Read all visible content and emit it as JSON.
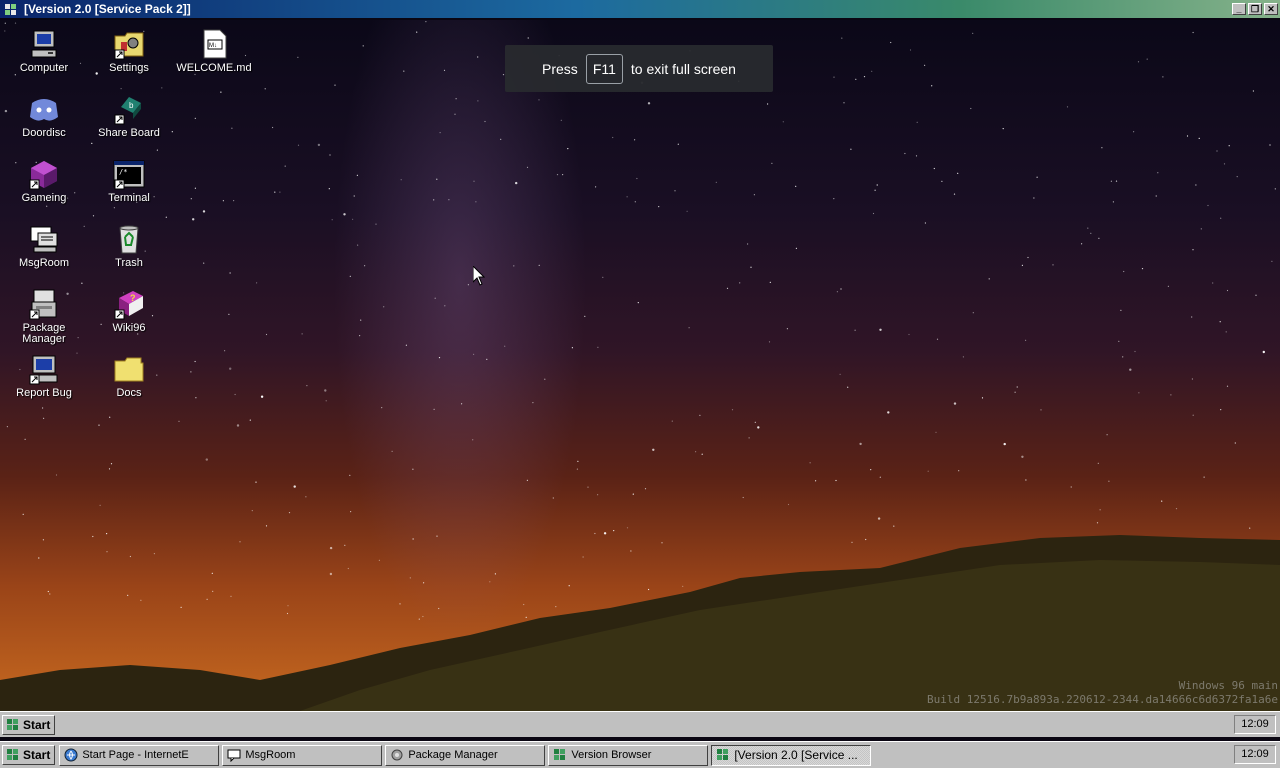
{
  "window": {
    "title": "[Version 2.0 [Service Pack 2]]",
    "controls": [
      "minimize-icon",
      "restore-icon",
      "close-icon"
    ]
  },
  "desktop": {
    "icons": [
      {
        "label": "Computer",
        "icon": "computer-icon"
      },
      {
        "label": "Settings",
        "icon": "settings-icon"
      },
      {
        "label": "WELCOME.md",
        "icon": "markdown-file-icon"
      },
      {
        "label": "Doordisc",
        "icon": "discord-icon"
      },
      {
        "label": "Share Board",
        "icon": "share-board-icon"
      },
      {
        "label": "Gameing",
        "icon": "game-cube-icon"
      },
      {
        "label": "Terminal",
        "icon": "terminal-icon"
      },
      {
        "label": "MsgRoom",
        "icon": "msgroom-icon"
      },
      {
        "label": "Trash",
        "icon": "recycle-bin-icon"
      },
      {
        "label": "Package Manager",
        "icon": "package-manager-icon"
      },
      {
        "label": "Wiki96",
        "icon": "help-book-icon"
      },
      {
        "label": "Report Bug",
        "icon": "report-bug-icon"
      },
      {
        "label": "Docs",
        "icon": "folder-icon"
      }
    ],
    "fullscreen_notice": {
      "press": "Press",
      "key": "F11",
      "rest": "to exit full screen"
    },
    "watermark": {
      "line1": "Windows 96 main",
      "line2": "Build 12516.7b9a893a.220612-2344.da14666c6d6372fa1a6e"
    }
  },
  "taskbar_top": {
    "start_label": "Start",
    "clock": "12:09"
  },
  "taskbar_bottom": {
    "start_label": "Start",
    "clock": "12:09",
    "tasks": [
      {
        "label": "Start Page - InternetE",
        "icon": "internet-explorer-icon"
      },
      {
        "label": "MsgRoom",
        "icon": "msgroom-icon"
      },
      {
        "label": "Package Manager",
        "icon": "package-manager-icon"
      },
      {
        "label": "Version Browser",
        "icon": "windows96-logo-icon"
      },
      {
        "label": "[Version 2.0 [Service ...",
        "icon": "windows96-logo-icon",
        "active": true
      }
    ]
  },
  "colors": {
    "titlebar_start": "#0a246a",
    "titlebar_end": "#86b28a",
    "taskbar": "#c0c0c0",
    "notice_bg": "#282a2e"
  }
}
